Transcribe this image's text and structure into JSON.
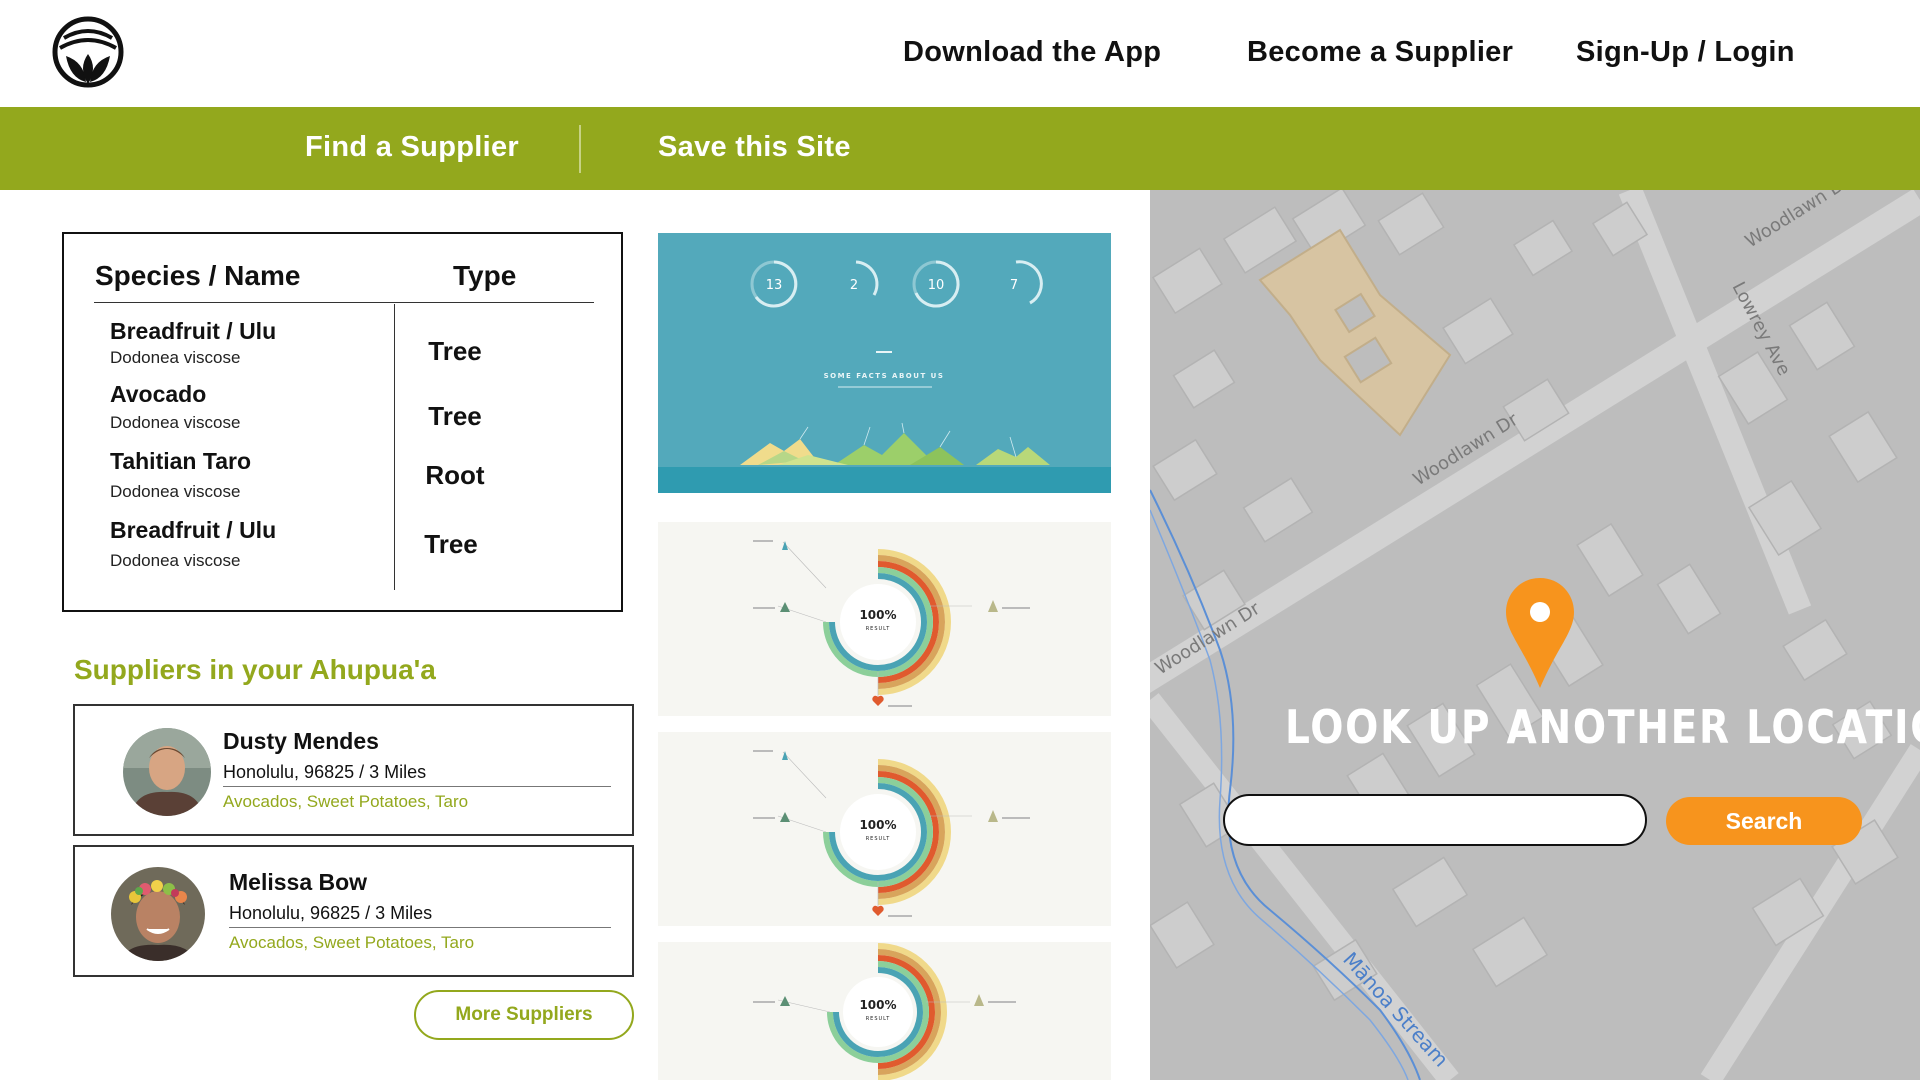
{
  "header": {
    "nav": [
      {
        "label": "Download the App"
      },
      {
        "label": "Become a Supplier"
      },
      {
        "label": "Sign-Up / Login"
      }
    ]
  },
  "subnav": {
    "items": [
      {
        "label": "Find a Supplier"
      },
      {
        "label": "Save this Site"
      }
    ]
  },
  "species_table": {
    "col_name": "Species / Name",
    "col_type": "Type",
    "rows": [
      {
        "name": "Breadfruit / Ulu",
        "scientific": "Dodonea viscose",
        "type": "Tree"
      },
      {
        "name": "Avocado",
        "scientific": "Dodonea viscose",
        "type": "Tree"
      },
      {
        "name": "Tahitian Taro",
        "scientific": "Dodonea viscose",
        "type": "Root"
      },
      {
        "name": "Breadfruit / Ulu",
        "scientific": "Dodonea viscose",
        "type": "Tree"
      }
    ]
  },
  "suppliers": {
    "heading": "Suppliers in your Ahupua'a",
    "items": [
      {
        "name": "Dusty Mendes",
        "location": "Honolulu, 96825 / 3 Miles",
        "crops": "Avocados, Sweet Potatoes, Taro"
      },
      {
        "name": "Melissa Bow",
        "location": "Honolulu, 96825 / 3 Miles",
        "crops": "Avocados, Sweet Potatoes, Taro"
      }
    ],
    "more_label": "More Suppliers"
  },
  "thumbnails": {
    "facts": {
      "stats": [
        "13",
        "2",
        "10",
        "7"
      ],
      "heading": "SOME FACTS ABOUT US"
    },
    "result_label": "100%",
    "result_sub": "RESULT"
  },
  "map": {
    "streets": [
      "Woodlawn Dr",
      "Woodlawn Dr",
      "Woodlawn Dr",
      "Lowrey Ave",
      "Mānoa Stream"
    ],
    "lookup_title": "LOOK UP ANOTHER LOCATION",
    "search_value": "",
    "search_button": "Search"
  },
  "colors": {
    "brand_green": "#93a81d",
    "accent_orange": "#f7941d",
    "map_gray": "#bdbdbd"
  },
  "icons": [
    "leaf-logo-icon",
    "location-pin-icon"
  ]
}
